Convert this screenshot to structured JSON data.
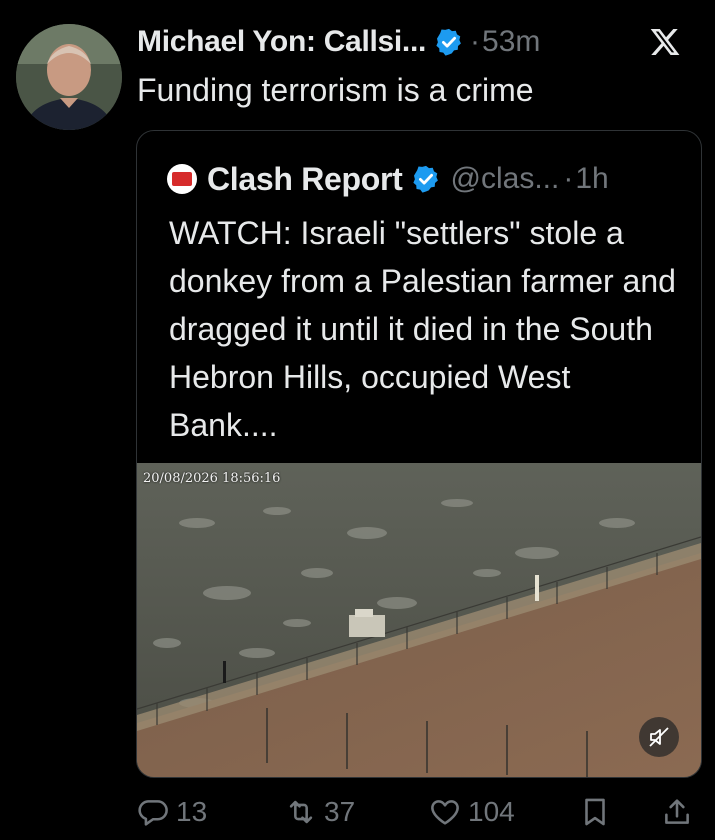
{
  "tweet": {
    "author_name": "Michael Yon: Callsi...",
    "dot": "·",
    "time": "53m",
    "text": "Funding terrorism is a crime"
  },
  "quoted": {
    "name": "Clash Report",
    "handle": "@clas...",
    "dot": "·",
    "time": "1h",
    "text": "WATCH: Israeli \"settlers\" stole a donkey from a Palestian farmer and dragged it until it died in the South Hebron Hills, occupied West Bank....",
    "media": {
      "timestamp": "20/08/2026 18:56:16"
    }
  },
  "actions": {
    "replies": "13",
    "reposts": "37",
    "likes": "104"
  },
  "icons": [
    "verified-badge-icon",
    "x-logo-icon",
    "clash-report-logo-icon",
    "mute-icon",
    "reply-icon",
    "repost-icon",
    "like-icon",
    "bookmark-icon",
    "share-icon"
  ],
  "colors": {
    "background": "#000000",
    "text": "#e7e9ea",
    "secondary": "#71767b",
    "verified": "#1d9bf0",
    "border": "#2f3336"
  }
}
